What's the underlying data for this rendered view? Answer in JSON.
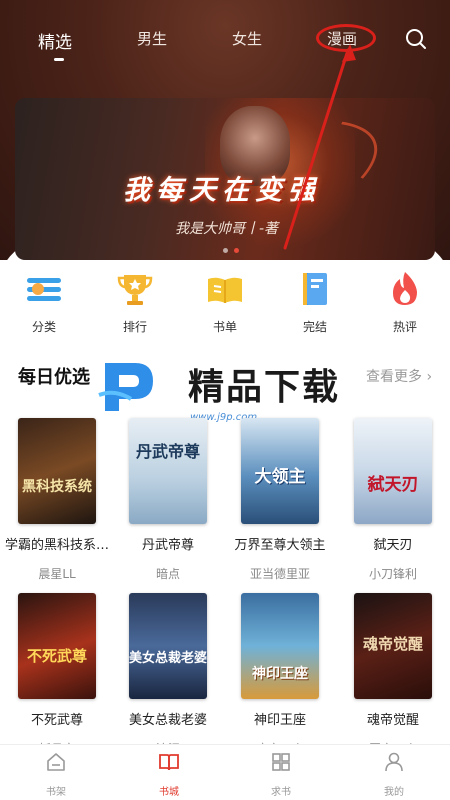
{
  "header": {
    "tabs": [
      {
        "label": "精选",
        "active": true
      },
      {
        "label": "男生",
        "active": false
      },
      {
        "label": "女生",
        "active": false
      },
      {
        "label": "漫画",
        "active": false
      }
    ],
    "search_icon": "search-icon"
  },
  "banner": {
    "title": "我每天在变强",
    "subtitle": "我是大帅哥丨-著",
    "dot_count": 2,
    "active_dot": 1
  },
  "categories": [
    {
      "label": "分类",
      "icon": "category-icon",
      "color": "#3aa0e8"
    },
    {
      "label": "排行",
      "icon": "trophy-icon",
      "color": "#f5b731"
    },
    {
      "label": "书单",
      "icon": "book-list-icon",
      "color": "#f5c431"
    },
    {
      "label": "完结",
      "icon": "finished-book-icon",
      "color": "#3a8de0"
    },
    {
      "label": "热评",
      "icon": "flame-icon",
      "color": "#f2504a"
    }
  ],
  "section": {
    "title": "每日优选",
    "more": "查看更多 ›"
  },
  "watermark": {
    "text": "精品下载",
    "url": "www.j9p.com"
  },
  "books": [
    {
      "title": "学霸的黑科技系…",
      "author": "晨星LL",
      "cover_text": "黑科技系统"
    },
    {
      "title": "丹武帝尊",
      "author": "暗点",
      "cover_text": "丹武帝尊"
    },
    {
      "title": "万界至尊大领主",
      "author": "亚当德里亚",
      "cover_text": "大领主"
    },
    {
      "title": "弑天刃",
      "author": "小刀锋利",
      "cover_text": "弑天刃"
    },
    {
      "title": "不死武尊",
      "author": "妖月夜",
      "cover_text": "不死武尊"
    },
    {
      "title": "美女总裁老婆",
      "author": "流泪",
      "cover_text": "美女总裁老婆"
    },
    {
      "title": "神印王座",
      "author": "唐家三少",
      "cover_text": "神印王座"
    },
    {
      "title": "魂帝觉醒",
      "author": "罪家三少",
      "cover_text": "魂帝觉醒"
    }
  ],
  "bottom_nav": [
    {
      "label": "书架",
      "icon": "bookshelf-icon",
      "active": false
    },
    {
      "label": "书城",
      "icon": "open-book-icon",
      "active": true
    },
    {
      "label": "求书",
      "icon": "grid-icon",
      "active": false
    },
    {
      "label": "我的",
      "icon": "profile-icon",
      "active": false
    }
  ],
  "colors": {
    "accent": "#e03a2e",
    "header_bg": "#4a2218",
    "annotation": "#d9201a"
  }
}
